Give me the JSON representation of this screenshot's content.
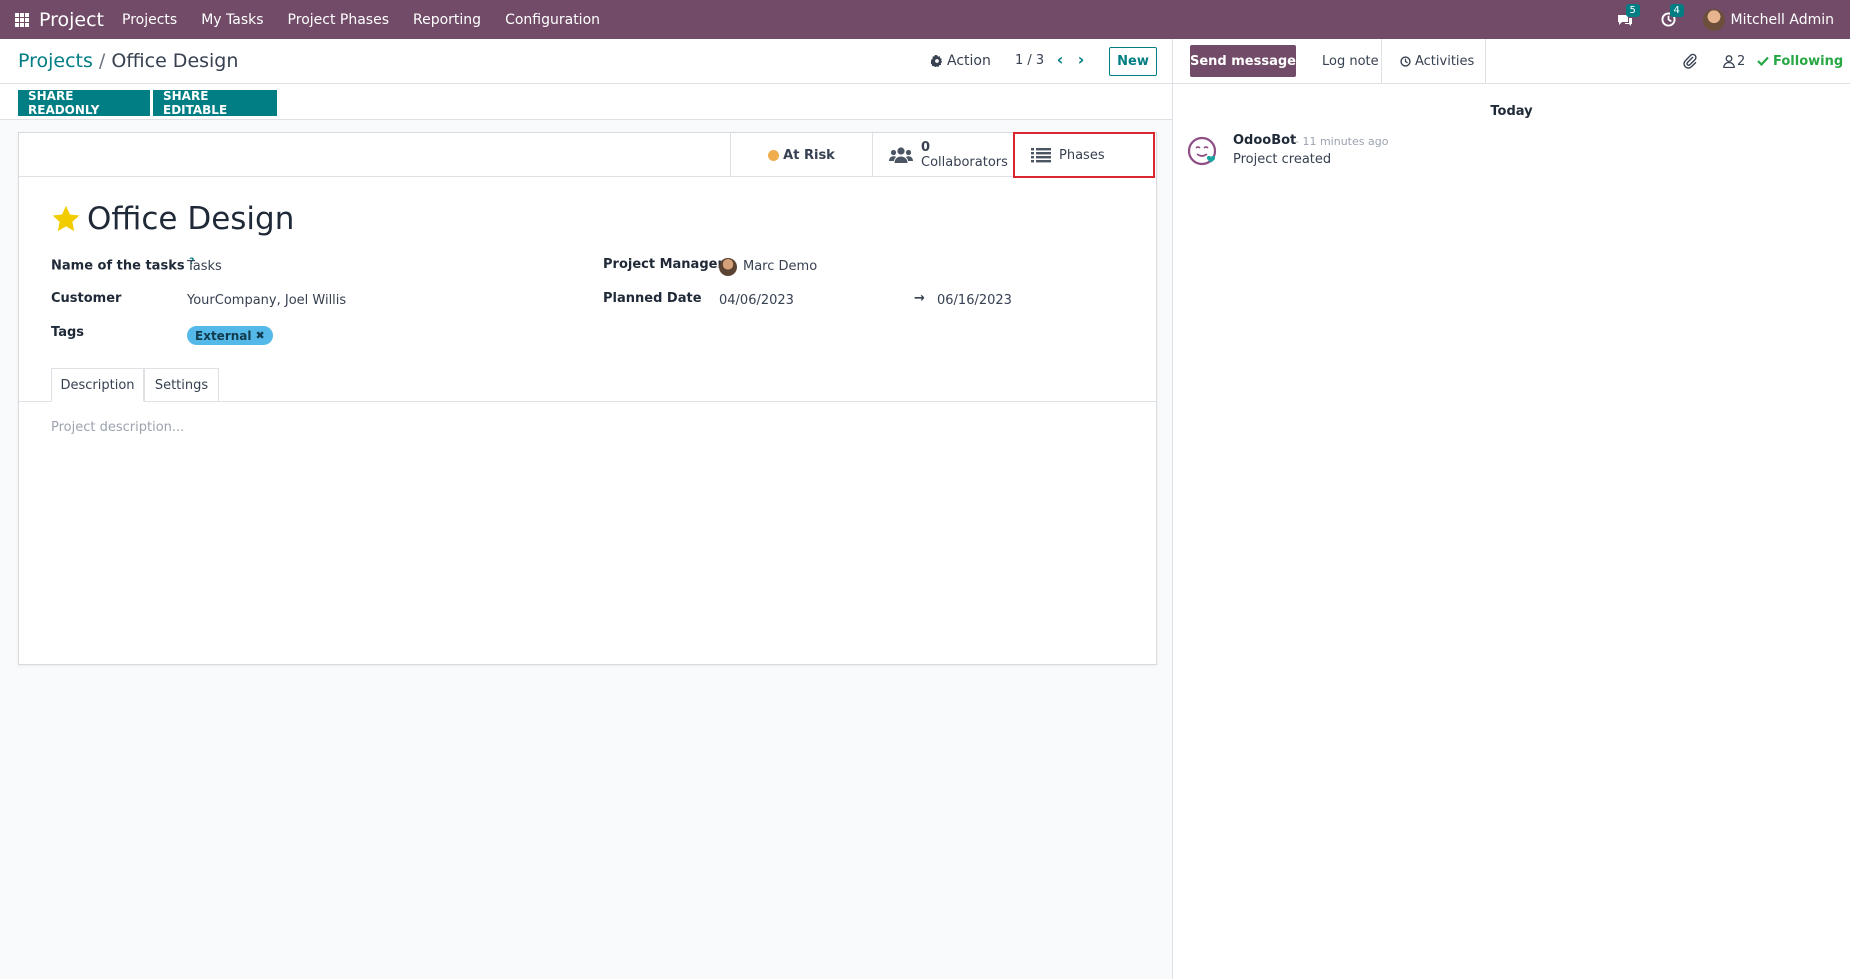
{
  "navbar": {
    "app_name": "Project",
    "menus": [
      "Projects",
      "My Tasks",
      "Project Phases",
      "Reporting",
      "Configuration"
    ],
    "messages_badge": "5",
    "activities_badge": "4",
    "user_name": "Mitchell Admin"
  },
  "control_panel": {
    "breadcrumb_parent": "Projects",
    "breadcrumb_separator": "/",
    "breadcrumb_current": "Office Design",
    "action_label": "Action",
    "pager": "1 / 3",
    "new_label": "New"
  },
  "header_buttons": {
    "share_readonly": "SHARE READONLY",
    "share_editable": "SHARE EDITABLE"
  },
  "smart_buttons": {
    "status": "At Risk",
    "collaborators_count": "0",
    "collaborators_label": "Collaborators",
    "phases_label": "Phases"
  },
  "form": {
    "title": "Office Design",
    "name_of_tasks_label": "Name of the tasks",
    "help_mark": "?",
    "name_of_tasks_value": "Tasks",
    "customer_label": "Customer",
    "customer_value": "YourCompany, Joel Willis",
    "tags_label": "Tags",
    "tag": "External",
    "tag_remove": "✖",
    "manager_label": "Project Manager",
    "manager_value": "Marc Demo",
    "planned_date_label": "Planned Date",
    "planned_date_start": "04/06/2023",
    "planned_date_arrow": "→",
    "planned_date_end": "06/16/2023",
    "tabs": [
      "Description",
      "Settings"
    ],
    "description_placeholder": "Project description..."
  },
  "chatter": {
    "send_message": "Send message",
    "log_note": "Log note",
    "activities": "Activities",
    "followers_count": "2",
    "following": "Following",
    "day": "Today",
    "message": {
      "author": "OdooBot",
      "time": "- 11 minutes ago",
      "body": "Project created"
    }
  },
  "colors": {
    "brand": "#714b67",
    "accent": "#017e84",
    "status_at_risk": "#f0ad4e",
    "tag": "#54b8e8",
    "highlight": "#d9262f",
    "following": "#28a745"
  }
}
